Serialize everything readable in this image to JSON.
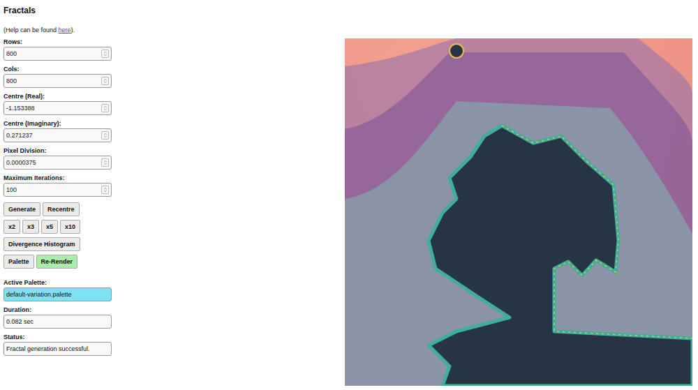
{
  "page": {
    "title": "Fractals",
    "help": {
      "prefix": "(Help can be found ",
      "link": "here",
      "suffix": ")."
    }
  },
  "fields": [
    {
      "label": "Rows:",
      "value": "800"
    },
    {
      "label": "Cols:",
      "value": "800"
    },
    {
      "label": "Centre (Real):",
      "value": "-1.153388"
    },
    {
      "label": "Centre (Imaginary):",
      "value": "0.271237"
    },
    {
      "label": "Pixel Division:",
      "value": "0.0000375"
    },
    {
      "label": "Maximum Iterations:",
      "value": "100"
    }
  ],
  "button_rows": [
    [
      {
        "label": "Generate",
        "highlighted": false
      },
      {
        "label": "Recentre",
        "highlighted": false
      }
    ],
    [
      {
        "label": "x2",
        "highlighted": false
      },
      {
        "label": "x3",
        "highlighted": false
      },
      {
        "label": "x5",
        "highlighted": false
      },
      {
        "label": "x10",
        "highlighted": false
      }
    ],
    [
      {
        "label": "Divergence Histogram",
        "highlighted": false
      }
    ],
    [
      {
        "label": "Palette",
        "highlighted": false
      },
      {
        "label": "Re-Render",
        "highlighted": true
      }
    ]
  ],
  "outputs": [
    {
      "label": "Active Palette:",
      "value": "default-variation.palette",
      "highlighted": true
    },
    {
      "label": "Duration:",
      "value": "0.082 sec",
      "highlighted": false
    },
    {
      "label": "Status:",
      "value": "Fractal generation successful.",
      "highlighted": false
    }
  ]
}
